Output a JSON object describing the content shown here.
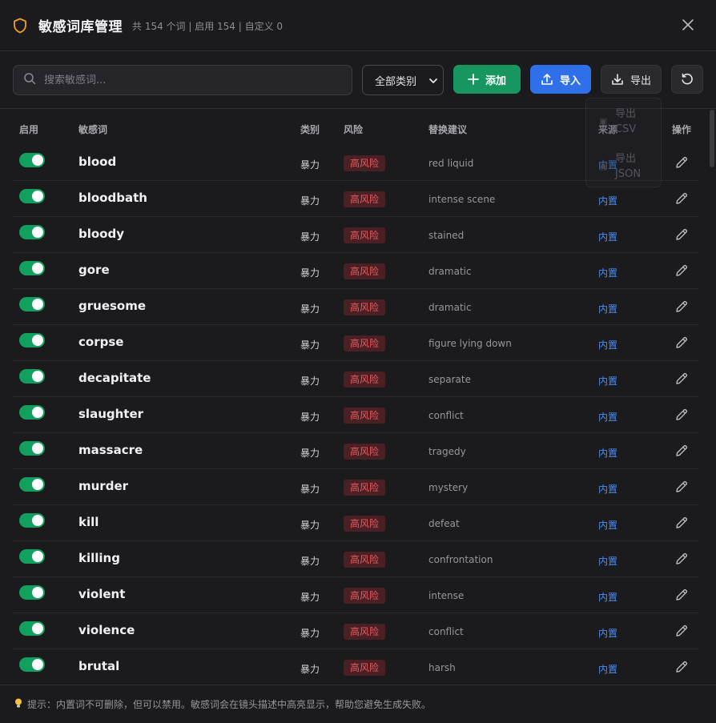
{
  "header": {
    "title": "敏感词库管理",
    "subtitle": "共 154 个词 | 启用 154 | 自定义 0"
  },
  "toolbar": {
    "search_placeholder": "搜索敏感词...",
    "category_select": "全部类别",
    "add_label": "添加",
    "import_label": "导入",
    "export_label": "导出"
  },
  "export_menu": {
    "csv_label": "导出 CSV",
    "json_label": "导出 JSON"
  },
  "table": {
    "columns": [
      "启用",
      "敏感词",
      "类别",
      "风险",
      "替换建议",
      "来源",
      "操作"
    ],
    "rows": [
      {
        "word": "blood",
        "category": "暴力",
        "risk": "高风险",
        "suggestion": "red liquid",
        "source": "内置",
        "enabled": true
      },
      {
        "word": "bloodbath",
        "category": "暴力",
        "risk": "高风险",
        "suggestion": "intense scene",
        "source": "内置",
        "enabled": true
      },
      {
        "word": "bloody",
        "category": "暴力",
        "risk": "高风险",
        "suggestion": "stained",
        "source": "内置",
        "enabled": true
      },
      {
        "word": "gore",
        "category": "暴力",
        "risk": "高风险",
        "suggestion": "dramatic",
        "source": "内置",
        "enabled": true
      },
      {
        "word": "gruesome",
        "category": "暴力",
        "risk": "高风险",
        "suggestion": "dramatic",
        "source": "内置",
        "enabled": true
      },
      {
        "word": "corpse",
        "category": "暴力",
        "risk": "高风险",
        "suggestion": "figure lying down",
        "source": "内置",
        "enabled": true
      },
      {
        "word": "decapitate",
        "category": "暴力",
        "risk": "高风险",
        "suggestion": "separate",
        "source": "内置",
        "enabled": true
      },
      {
        "word": "slaughter",
        "category": "暴力",
        "risk": "高风险",
        "suggestion": "conflict",
        "source": "内置",
        "enabled": true
      },
      {
        "word": "massacre",
        "category": "暴力",
        "risk": "高风险",
        "suggestion": "tragedy",
        "source": "内置",
        "enabled": true
      },
      {
        "word": "murder",
        "category": "暴力",
        "risk": "高风险",
        "suggestion": "mystery",
        "source": "内置",
        "enabled": true
      },
      {
        "word": "kill",
        "category": "暴力",
        "risk": "高风险",
        "suggestion": "defeat",
        "source": "内置",
        "enabled": true
      },
      {
        "word": "killing",
        "category": "暴力",
        "risk": "高风险",
        "suggestion": "confrontation",
        "source": "内置",
        "enabled": true
      },
      {
        "word": "violent",
        "category": "暴力",
        "risk": "高风险",
        "suggestion": "intense",
        "source": "内置",
        "enabled": true
      },
      {
        "word": "violence",
        "category": "暴力",
        "risk": "高风险",
        "suggestion": "conflict",
        "source": "内置",
        "enabled": true
      },
      {
        "word": "brutal",
        "category": "暴力",
        "risk": "高风险",
        "suggestion": "harsh",
        "source": "内置",
        "enabled": true
      }
    ]
  },
  "footer": {
    "tip": "提示：内置词不可删除，但可以禁用。敏感词会在镜头描述中高亮显示，帮助您避免生成失败。"
  },
  "colors": {
    "accent_green": "#17965f",
    "accent_blue": "#2f6fe8",
    "risk_red": "#e35d62",
    "shield_orange": "#f0a020"
  },
  "icons": {
    "title": "shield-icon",
    "close": "close-icon",
    "search": "search-icon",
    "add": "plus-icon",
    "import": "upload-icon",
    "export": "download-icon",
    "refresh": "refresh-icon",
    "edit": "pencil-icon",
    "tip": "lightbulb-icon"
  }
}
